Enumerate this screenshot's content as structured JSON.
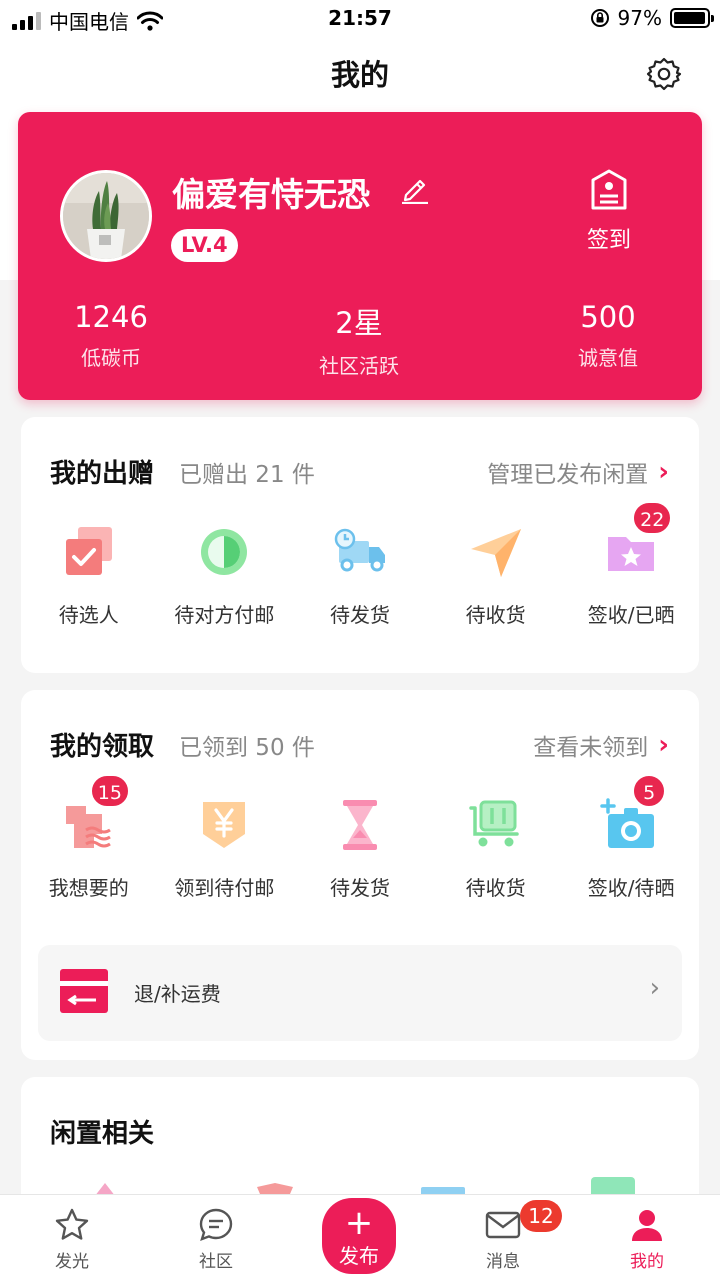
{
  "status_bar": {
    "carrier": "中国电信",
    "time": "21:57",
    "battery": "97%",
    "battery_level": 0.97
  },
  "header": {
    "title": "我的",
    "settings_icon": "gear-icon"
  },
  "profile": {
    "username": "偏爱有恃无恐",
    "level": "LV.4",
    "checkin_label": "签到",
    "stats": [
      {
        "value": "1246",
        "label": "低碳币"
      },
      {
        "value": "2星",
        "label": "社区活跃"
      },
      {
        "value": "500",
        "label": "诚意值"
      }
    ]
  },
  "my_giving": {
    "title": "我的出赠",
    "subtitle": "已赠出 21 件",
    "link": "管理已发布闲置",
    "items": [
      {
        "label": "待选人",
        "icon": "checkbox-stack-icon",
        "badge": ""
      },
      {
        "label": "待对方付邮",
        "icon": "clock-icon",
        "badge": ""
      },
      {
        "label": "待发货",
        "icon": "delivery-truck-icon",
        "badge": ""
      },
      {
        "label": "待收货",
        "icon": "paper-plane-icon",
        "badge": ""
      },
      {
        "label": "签收/已晒",
        "icon": "star-folder-icon",
        "badge": "22"
      }
    ]
  },
  "my_receiving": {
    "title": "我的领取",
    "subtitle": "已领到 50 件",
    "link": "查看未领到",
    "items": [
      {
        "label": "我想要的",
        "icon": "wish-shirt-icon",
        "badge": "15"
      },
      {
        "label": "领到待付邮",
        "icon": "yen-tag-icon",
        "badge": ""
      },
      {
        "label": "待发货",
        "icon": "hourglass-icon",
        "badge": ""
      },
      {
        "label": "待收货",
        "icon": "cart-icon",
        "badge": ""
      },
      {
        "label": "签收/待晒",
        "icon": "camera-icon",
        "badge": "5"
      }
    ],
    "refund_label": "退/补运费"
  },
  "idle": {
    "title": "闲置相关"
  },
  "tabbar": {
    "tabs": [
      {
        "label": "发光",
        "icon": "star-icon"
      },
      {
        "label": "社区",
        "icon": "chat-bubble-icon"
      },
      {
        "label": "消息",
        "icon": "mail-icon"
      },
      {
        "label": "我的",
        "icon": "user-icon"
      }
    ],
    "publish_plus": "+",
    "publish_label": "发布",
    "message_badge": "12"
  },
  "colors": {
    "brand": "#ec1d58",
    "badge": "#e8274f"
  }
}
